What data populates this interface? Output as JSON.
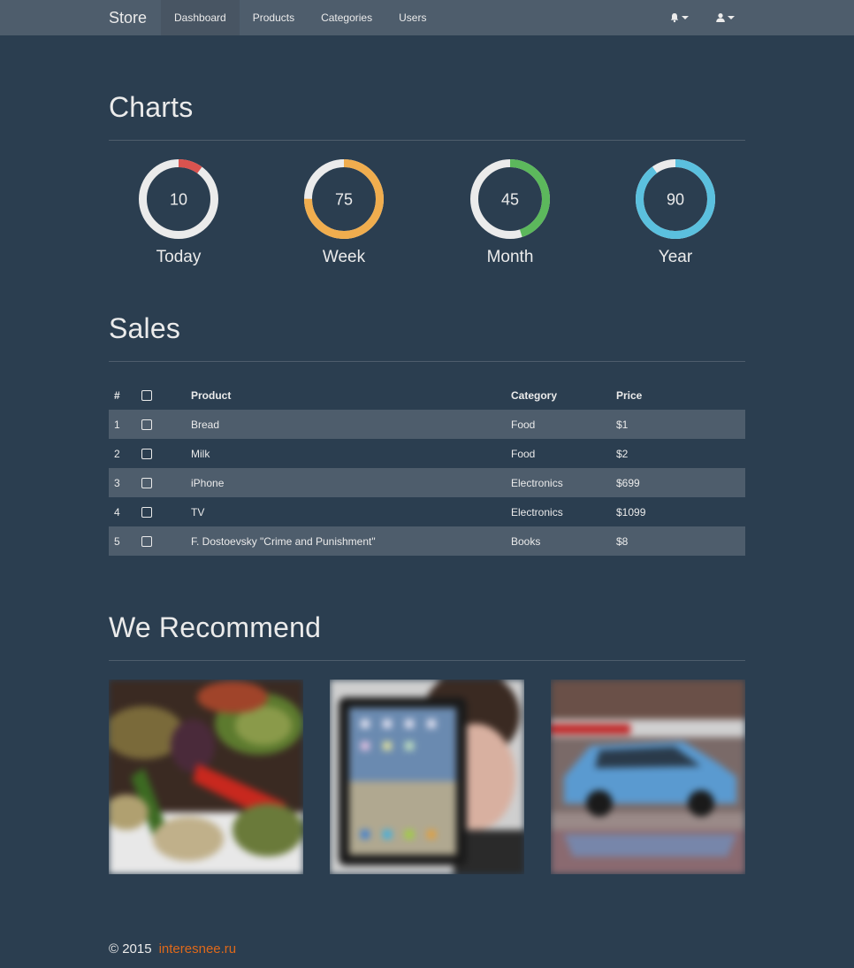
{
  "navbar": {
    "brand": "Store",
    "items": [
      {
        "label": "Dashboard",
        "active": true
      },
      {
        "label": "Products",
        "active": false
      },
      {
        "label": "Categories",
        "active": false
      },
      {
        "label": "Users",
        "active": false
      }
    ],
    "right_icons": [
      "bell-icon",
      "user-icon"
    ]
  },
  "charts": {
    "title": "Charts",
    "items": [
      {
        "value": "10",
        "label": "Today",
        "percent": 10,
        "color": "#d9534f"
      },
      {
        "value": "75",
        "label": "Week",
        "percent": 75,
        "color": "#f0ad4e"
      },
      {
        "value": "45",
        "label": "Month",
        "percent": 45,
        "color": "#5cb85c"
      },
      {
        "value": "90",
        "label": "Year",
        "percent": 90,
        "color": "#5bc0de"
      }
    ],
    "track_color": "#ebebeb"
  },
  "sales": {
    "title": "Sales",
    "columns": [
      "#",
      "",
      "Product",
      "Category",
      "Price"
    ],
    "rows": [
      {
        "num": "1",
        "product": "Bread",
        "category": "Food",
        "price": "$1"
      },
      {
        "num": "2",
        "product": "Milk",
        "category": "Food",
        "price": "$2"
      },
      {
        "num": "3",
        "product": "iPhone",
        "category": "Electronics",
        "price": "$699"
      },
      {
        "num": "4",
        "product": "TV",
        "category": "Electronics",
        "price": "$1099"
      },
      {
        "num": "5",
        "product": "F. Dostoevsky \"Crime and Punishment\"",
        "category": "Books",
        "price": "$8"
      }
    ]
  },
  "recommend": {
    "title": "We Recommend",
    "items": [
      "grilled-vegetables-image",
      "tablet-image",
      "blue-car-image"
    ]
  },
  "footer": {
    "copyright": "© 2015",
    "link": "interesnee.ru",
    "link_color": "#df691a"
  },
  "colors": {
    "background": "#2b3e50",
    "navbar": "#4e5d6c",
    "accent": "#df691a"
  }
}
